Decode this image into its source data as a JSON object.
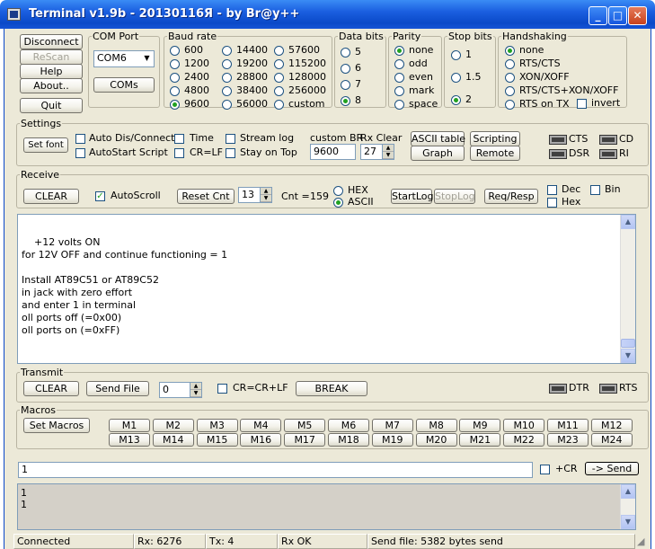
{
  "window": {
    "title": "Terminal v1.9b - 20130116Я - by Br@y++"
  },
  "conn": {
    "disconnect": "Disconnect",
    "rescan": "ReScan",
    "help": "Help",
    "about": "About..",
    "quit": "Quit"
  },
  "comport": {
    "legend": "COM Port",
    "value": "COM6",
    "coms": "COMs"
  },
  "baud": {
    "legend": "Baud rate",
    "options": [
      "600",
      "1200",
      "2400",
      "4800",
      "9600",
      "14400",
      "19200",
      "28800",
      "38400",
      "56000",
      "57600",
      "115200",
      "128000",
      "256000",
      "custom"
    ],
    "selected": "9600"
  },
  "databits": {
    "legend": "Data bits",
    "options": [
      "5",
      "6",
      "7",
      "8"
    ],
    "selected": "8"
  },
  "parity": {
    "legend": "Parity",
    "options": [
      "none",
      "odd",
      "even",
      "mark",
      "space"
    ],
    "selected": "none"
  },
  "stopbits": {
    "legend": "Stop bits",
    "options": [
      "1",
      "1.5",
      "2"
    ],
    "selected": "2"
  },
  "handshaking": {
    "legend": "Handshaking",
    "options": [
      "none",
      "RTS/CTS",
      "XON/XOFF",
      "RTS/CTS+XON/XOFF",
      "RTS on TX"
    ],
    "selected": "none",
    "invert": "invert"
  },
  "settings": {
    "legend": "Settings",
    "setfont": "Set font",
    "autodis": "Auto Dis/Connect",
    "autostart": "AutoStart Script",
    "time": "Time",
    "crlf": "CR=LF",
    "streamlog": "Stream log",
    "stayontop": "Stay on Top",
    "custombr_label": "custom BR",
    "custombr_value": "9600",
    "rxclear_label": "Rx Clear",
    "rxclear_value": "27",
    "ascii": "ASCII table",
    "graph": "Graph",
    "scripting": "Scripting",
    "remote": "Remote",
    "leds": [
      "CTS",
      "CD",
      "DSR",
      "RI"
    ]
  },
  "receive": {
    "legend": "Receive",
    "clear": "CLEAR",
    "autoscroll": "AutoScroll",
    "resetcnt": "Reset Cnt",
    "cnt_sel": "13",
    "cnt_label": "Cnt =",
    "cnt_value": "159",
    "hex": "HEX",
    "ascii": "ASCII",
    "startlog": "StartLog",
    "stoplog": "StopLog",
    "reqresp": "Req/Resp",
    "dec": "Dec",
    "bin": "Bin",
    "hexchk": "Hex",
    "text": "\n    +12 volts ON\nfor 12V OFF and continue functioning = 1\n\nInstall AT89C51 or AT89C52\nin jack with zero effort\nand enter 1 in terminal\noll ports off (=0x00)\noll ports on (=0xFF)"
  },
  "transmit": {
    "legend": "Transmit",
    "clear": "CLEAR",
    "sendfile": "Send File",
    "counter": "0",
    "crcrlf": "CR=CR+LF",
    "break": "BREAK",
    "dtr": "DTR",
    "rts": "RTS"
  },
  "macros": {
    "legend": "Macros",
    "set": "Set Macros",
    "items": [
      "M1",
      "M2",
      "M3",
      "M4",
      "M5",
      "M6",
      "M7",
      "M8",
      "M9",
      "M10",
      "M11",
      "M12",
      "M13",
      "M14",
      "M15",
      "M16",
      "M17",
      "M18",
      "M19",
      "M20",
      "M21",
      "M22",
      "M23",
      "M24"
    ]
  },
  "send": {
    "input_value": "1",
    "cr": "+CR",
    "button": "-> Send"
  },
  "tx_log": "1\n1",
  "status": {
    "conn": "Connected",
    "rx": "Rx: 6276",
    "tx": "Tx: 4",
    "rxok": "Rx OK",
    "sendfile": "Send file: 5382 bytes send"
  }
}
